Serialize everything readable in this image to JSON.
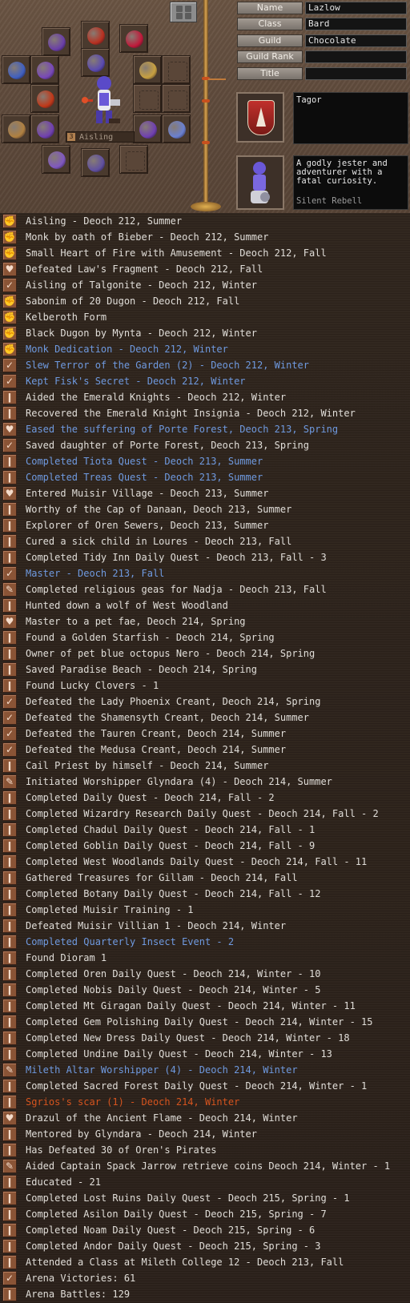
{
  "profile": {
    "fields": [
      {
        "label": "Name",
        "value": "Lazlow"
      },
      {
        "label": "Class",
        "value": "Bard"
      },
      {
        "label": "Guild",
        "value": "Chocolate"
      },
      {
        "label": "Guild Rank",
        "value": ""
      },
      {
        "label": "Title",
        "value": ""
      }
    ],
    "legend_title": "Tagor",
    "profile_text": "A godly jester and adventurer with a fatal curiosity.",
    "signature": "Silent Rebell",
    "level_box_text": "Aisling"
  },
  "equipment": {
    "slots": [
      {
        "icon": "gauntlets-icon",
        "color": "#6a3fa8"
      },
      {
        "icon": "earring-icon",
        "color": "#b83020"
      },
      {
        "icon": "necklace-icon",
        "color": "#c01a3a"
      },
      {
        "icon": "armor-icon",
        "color": "#4060c0"
      },
      {
        "icon": "belt-icon",
        "color": "#7848b8"
      },
      {
        "icon": "ring-icon",
        "color": "#5a4ab0"
      },
      {
        "icon": "bow-icon",
        "color": "#c8a040"
      },
      {
        "icon": "empty-slot",
        "color": ""
      },
      {
        "icon": "staff-icon",
        "color": "#c03818"
      },
      {
        "icon": "empty-slot",
        "color": ""
      },
      {
        "icon": "empty-slot",
        "color": ""
      },
      {
        "icon": "horn-icon",
        "color": "#b08040"
      },
      {
        "icon": "bracer-icon",
        "color": "#7040b0"
      },
      {
        "icon": "bracer-icon",
        "color": "#7040b0"
      },
      {
        "icon": "wand-icon",
        "color": "#6a80d0"
      },
      {
        "icon": "boots-icon",
        "color": "#8058c0"
      },
      {
        "icon": "charm-icon",
        "color": "#6050a0"
      },
      {
        "icon": "empty-slot",
        "color": ""
      }
    ]
  },
  "legend": [
    {
      "icon": "fist-icon",
      "text": "Aisling - Deoch 212, Summer",
      "color": "white"
    },
    {
      "icon": "fist-icon",
      "text": "Monk by oath of Bieber - Deoch 212, Summer",
      "color": "white"
    },
    {
      "icon": "fist-icon",
      "text": "Small Heart of Fire with Amusement - Deoch 212, Fall",
      "color": "white"
    },
    {
      "icon": "heart-icon",
      "text": "Defeated Law's Fragment - Deoch 212, Fall",
      "color": "white"
    },
    {
      "icon": "check-icon",
      "text": "Aisling of Talgonite - Deoch 212, Winter",
      "color": "white"
    },
    {
      "icon": "fist-icon",
      "text": "Sabonim of 20 Dugon - Deoch 212, Fall",
      "color": "white"
    },
    {
      "icon": "fist-icon",
      "text": "Kelberoth Form",
      "color": "white"
    },
    {
      "icon": "fist-icon",
      "text": "Black Dugon by Mynta - Deoch 212, Winter",
      "color": "white"
    },
    {
      "icon": "fist-icon",
      "text": "Monk Dedication - Deoch 212, Winter",
      "color": "blue"
    },
    {
      "icon": "check-icon",
      "text": "Slew Terror of the Garden (2) - Deoch 212, Winter",
      "color": "blue"
    },
    {
      "icon": "check-icon",
      "text": "Kept Fisk's Secret - Deoch 212, Winter",
      "color": "blue"
    },
    {
      "icon": "scroll-icon",
      "text": "Aided the Emerald Knights - Deoch 212, Winter",
      "color": "white"
    },
    {
      "icon": "scroll-icon",
      "text": "Recovered the Emerald Knight Insignia - Deoch 212, Winter",
      "color": "white"
    },
    {
      "icon": "heart-icon",
      "text": "Eased the suffering of Porte Forest, Deoch 213, Spring",
      "color": "blue"
    },
    {
      "icon": "check-icon",
      "text": "Saved daughter of Porte Forest, Deoch 213, Spring",
      "color": "white"
    },
    {
      "icon": "scroll-icon",
      "text": "Completed Tiota Quest - Deoch 213, Summer",
      "color": "blue"
    },
    {
      "icon": "scroll-icon",
      "text": "Completed Treas Quest - Deoch 213, Summer",
      "color": "blue"
    },
    {
      "icon": "heart-icon",
      "text": "Entered Muisir Village - Deoch 213, Summer",
      "color": "white"
    },
    {
      "icon": "scroll-icon",
      "text": "Worthy of the Cap of Danaan, Deoch 213, Summer",
      "color": "white"
    },
    {
      "icon": "scroll-icon",
      "text": "Explorer of Oren Sewers, Deoch 213, Summer",
      "color": "white"
    },
    {
      "icon": "scroll-icon",
      "text": "Cured a sick child in Loures - Deoch 213, Fall",
      "color": "white"
    },
    {
      "icon": "scroll-icon",
      "text": "Completed Tidy Inn Daily Quest - Deoch 213, Fall - 3",
      "color": "white"
    },
    {
      "icon": "check-icon",
      "text": "Master - Deoch 213, Fall",
      "color": "blue"
    },
    {
      "icon": "tool-icon",
      "text": "Completed religious geas for Nadja - Deoch 213, Fall",
      "color": "white"
    },
    {
      "icon": "scroll-icon",
      "text": "Hunted down a wolf of West Woodland",
      "color": "white"
    },
    {
      "icon": "heart-icon",
      "text": "Master to a pet fae, Deoch 214, Spring",
      "color": "white"
    },
    {
      "icon": "scroll-icon",
      "text": "Found a Golden Starfish - Deoch 214, Spring",
      "color": "white"
    },
    {
      "icon": "scroll-icon",
      "text": "Owner of pet blue octopus Nero - Deoch 214, Spring",
      "color": "white"
    },
    {
      "icon": "scroll-icon",
      "text": "Saved Paradise Beach - Deoch 214, Spring",
      "color": "white"
    },
    {
      "icon": "scroll-icon",
      "text": "Found Lucky Clovers - 1",
      "color": "white"
    },
    {
      "icon": "check-icon",
      "text": "Defeated the Lady Phoenix Creant, Deoch 214, Spring",
      "color": "white"
    },
    {
      "icon": "check-icon",
      "text": "Defeated the Shamensyth Creant, Deoch 214, Summer",
      "color": "white"
    },
    {
      "icon": "check-icon",
      "text": "Defeated the Tauren Creant, Deoch 214, Summer",
      "color": "white"
    },
    {
      "icon": "check-icon",
      "text": "Defeated the Medusa Creant, Deoch 214, Summer",
      "color": "white"
    },
    {
      "icon": "scroll-icon",
      "text": "Cail Priest by himself - Deoch 214, Summer",
      "color": "white"
    },
    {
      "icon": "tool-icon",
      "text": "Initiated Worshipper Glyndara (4) - Deoch 214, Summer",
      "color": "white"
    },
    {
      "icon": "scroll-icon",
      "text": "Completed Daily Quest - Deoch 214, Fall - 2",
      "color": "white"
    },
    {
      "icon": "scroll-icon",
      "text": "Completed Wizardry Research Daily Quest - Deoch 214, Fall - 2",
      "color": "white"
    },
    {
      "icon": "scroll-icon",
      "text": "Completed Chadul Daily Quest - Deoch 214, Fall - 1",
      "color": "white"
    },
    {
      "icon": "scroll-icon",
      "text": "Completed Goblin Daily Quest - Deoch 214, Fall - 9",
      "color": "white"
    },
    {
      "icon": "scroll-icon",
      "text": "Completed West Woodlands Daily Quest - Deoch 214, Fall - 11",
      "color": "white"
    },
    {
      "icon": "scroll-icon",
      "text": "Gathered Treasures for Gillam - Deoch 214, Fall",
      "color": "white"
    },
    {
      "icon": "scroll-icon",
      "text": "Completed Botany Daily Quest - Deoch 214, Fall - 12",
      "color": "white"
    },
    {
      "icon": "scroll-icon",
      "text": "Completed Muisir Training - 1",
      "color": "white"
    },
    {
      "icon": "scroll-icon",
      "text": "Defeated Muisir Villian 1 - Deoch 214, Winter",
      "color": "white"
    },
    {
      "icon": "scroll-icon",
      "text": "Completed Quarterly Insect Event - 2",
      "color": "blue"
    },
    {
      "icon": "scroll-icon",
      "text": "Found Dioram 1",
      "color": "white"
    },
    {
      "icon": "scroll-icon",
      "text": "Completed Oren Daily Quest - Deoch 214, Winter - 10",
      "color": "white"
    },
    {
      "icon": "scroll-icon",
      "text": "Completed Nobis Daily Quest - Deoch 214, Winter - 5",
      "color": "white"
    },
    {
      "icon": "scroll-icon",
      "text": "Completed Mt Giragan Daily Quest - Deoch 214, Winter - 11",
      "color": "white"
    },
    {
      "icon": "scroll-icon",
      "text": "Completed Gem Polishing Daily Quest - Deoch 214, Winter - 15",
      "color": "white"
    },
    {
      "icon": "scroll-icon",
      "text": "Completed New Dress Daily Quest - Deoch 214, Winter - 18",
      "color": "white"
    },
    {
      "icon": "scroll-icon",
      "text": "Completed Undine Daily Quest - Deoch 214, Winter - 13",
      "color": "white"
    },
    {
      "icon": "tool-icon",
      "text": "Mileth Altar Worshipper (4) - Deoch 214, Winter",
      "color": "blue"
    },
    {
      "icon": "scroll-icon",
      "text": "Completed Sacred Forest Daily Quest - Deoch 214, Winter - 1",
      "color": "white"
    },
    {
      "icon": "scroll-icon",
      "text": "Sgrios's scar (1) - Deoch 214, Winter",
      "color": "orange"
    },
    {
      "icon": "heart-icon",
      "text": "Drazul of the Ancient Flame - Deoch 214, Winter",
      "color": "white"
    },
    {
      "icon": "scroll-icon",
      "text": "Mentored by Glyndara - Deoch 214, Winter",
      "color": "white"
    },
    {
      "icon": "scroll-icon",
      "text": "Has Defeated 30 of Oren's Pirates",
      "color": "white"
    },
    {
      "icon": "tool-icon",
      "text": "Aided Captain Spack Jarrow retrieve coins  Deoch 214, Winter - 1",
      "color": "white"
    },
    {
      "icon": "scroll-icon",
      "text": "Educated - 21",
      "color": "white"
    },
    {
      "icon": "scroll-icon",
      "text": "Completed Lost Ruins Daily Quest - Deoch 215, Spring - 1",
      "color": "white"
    },
    {
      "icon": "scroll-icon",
      "text": "Completed Asilon Daily Quest - Deoch 215, Spring - 7",
      "color": "white"
    },
    {
      "icon": "scroll-icon",
      "text": "Completed Noam Daily Quest - Deoch 215, Spring - 6",
      "color": "white"
    },
    {
      "icon": "scroll-icon",
      "text": "Completed Andor Daily Quest - Deoch 215, Spring - 3",
      "color": "white"
    },
    {
      "icon": "scroll-icon",
      "text": "Attended a Class at Mileth College 12 - Deoch 213, Fall",
      "color": "white"
    },
    {
      "icon": "check-icon",
      "text": "Arena Victories: 61",
      "color": "white"
    },
    {
      "icon": "scroll-icon",
      "text": "Arena Battles: 129",
      "color": "white"
    }
  ]
}
